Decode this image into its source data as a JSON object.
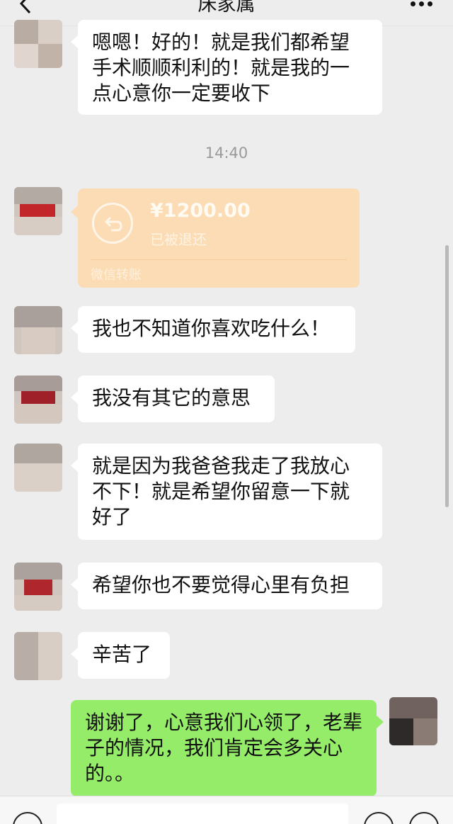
{
  "header": {
    "title": "床家属",
    "back_icon": "chevron-left-icon",
    "more_icon": "ellipsis-icon"
  },
  "messages": [
    {
      "side": "left",
      "text": "嗯嗯！好的！就是我们都希望手术顺顺利利的！就是我的一点心意你一定要收下"
    },
    {
      "type": "time",
      "text": "14:40"
    },
    {
      "side": "left",
      "type": "transfer",
      "amount": "¥1200.00",
      "status": "已被退还",
      "label": "微信转账"
    },
    {
      "side": "left",
      "text": "我也不知道你喜欢吃什么！"
    },
    {
      "side": "left",
      "text": "我没有其它的意思"
    },
    {
      "side": "left",
      "text": "就是因为我爸爸我走了我放心不下！就是希望你留意一下就好了"
    },
    {
      "side": "left",
      "text": "希望你也不要觉得心里有负担"
    },
    {
      "side": "left",
      "text": "辛苦了"
    },
    {
      "side": "right",
      "text": "谢谢了，心意我们心领了，老辈子的情况，我们肯定会多关心的。。"
    }
  ],
  "colors": {
    "background": "#ededed",
    "bubble_left": "#ffffff",
    "bubble_right": "#95ec69",
    "transfer_card": "#fbdcb5"
  }
}
